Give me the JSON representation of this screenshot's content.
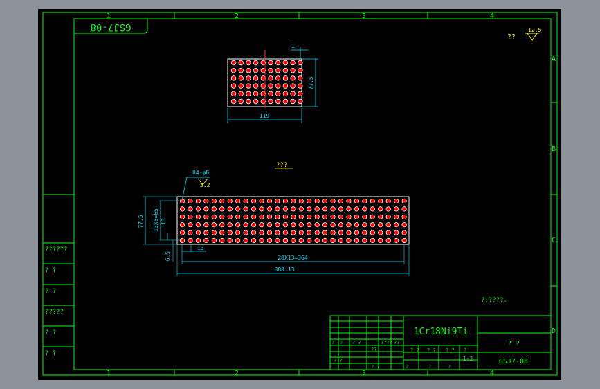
{
  "colors": {
    "outer_bg": "#8c939a",
    "sheet_bg": "#000000",
    "frame_line": "#00ff00",
    "title_text": "#00ff00",
    "dimension": "#00e5ff",
    "hole_fill": "#ff0000",
    "hole_ring": "#ffffff",
    "white_line": "#ffffff",
    "centerline": "#ff2a2a",
    "annotation": "#ffff00"
  },
  "zone_labels": {
    "columns": [
      "1",
      "2",
      "3",
      "4"
    ],
    "rows": [
      "A",
      "B",
      "C",
      "D"
    ]
  },
  "drawing_number_stamp": "GSJ7-08",
  "roughness": {
    "marks": "??",
    "value": "12.5"
  },
  "note_center": "???",
  "note_tech": "?:????.",
  "top_view": {
    "width_dim": "119",
    "height_dim": "77.5",
    "thickness_dim": "1",
    "grid": {
      "rows": 6,
      "cols": 10
    }
  },
  "main_view": {
    "hole_callout": "84-φ8",
    "roughness_value": "3.2",
    "height_dim": "77.5",
    "pitch_v_dim": "13X5=65",
    "edge_v_dim": "13",
    "pitch_h_small": "13",
    "edge_h_dim": "6.5",
    "pitch_dim": "28X13=364",
    "length_dim": "380.13",
    "grid": {
      "rows": 6,
      "cols": 29
    }
  },
  "side_labels": [
    "??????",
    "?   ?",
    "?   ?",
    "?????",
    "?   ?",
    "?   ?"
  ],
  "title_block": {
    "material": "1Cr18Ni9Ti",
    "part_name": "? ?",
    "drawing_no": "GSJ7-08",
    "scale": "1:2",
    "small_labels": [
      "?",
      "?",
      "? ?",
      "????",
      "??",
      "??",
      "? ?",
      "? ?",
      "? ?",
      "?",
      "?",
      "?",
      "?",
      "? ?",
      "? ?"
    ]
  }
}
